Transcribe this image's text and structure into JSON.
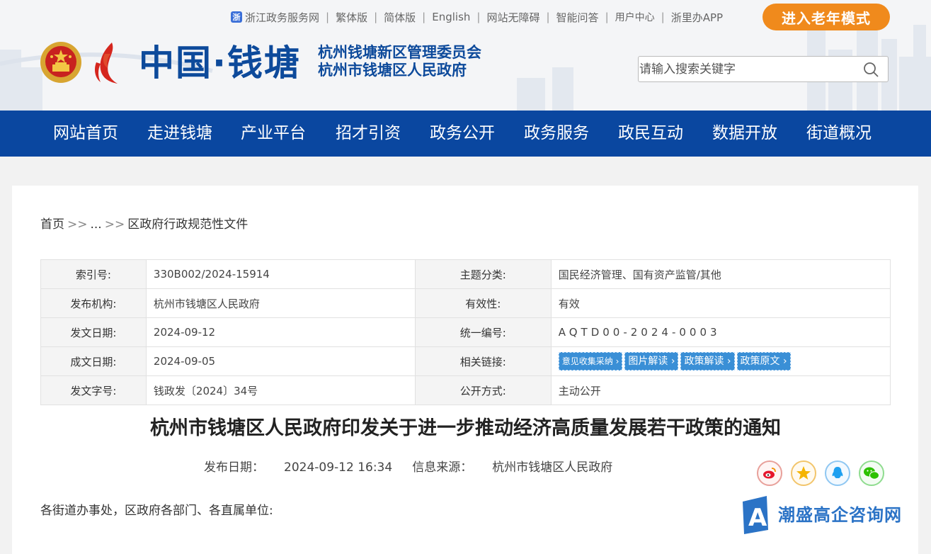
{
  "top_links": [
    "浙江政务服务网",
    "繁体版",
    "简体版",
    "English",
    "网站无障碍",
    "智能问答",
    "用户中心",
    "浙里办APP"
  ],
  "elder_mode_label": "进入老年模式",
  "brand": {
    "name": "中国·钱塘",
    "sub_line1": "杭州钱塘新区管理委员会",
    "sub_line2": "杭州市钱塘区人民政府"
  },
  "search": {
    "placeholder": "请输入搜索关键字"
  },
  "nav": [
    "网站首页",
    "走进钱塘",
    "产业平台",
    "招才引资",
    "政务公开",
    "政务服务",
    "政民互动",
    "数据开放",
    "街道概况"
  ],
  "breadcrumb": {
    "home": "首页",
    "sep": ">>",
    "ellipsis": "...",
    "current": "区政府行政规范性文件"
  },
  "meta": {
    "index_no_label": "索引号:",
    "index_no": "330B002/2024-15914",
    "topic_label": "主题分类:",
    "topic": "国民经济管理、国有资产监管/其他",
    "publisher_label": "发布机构:",
    "publisher": "杭州市钱塘区人民政府",
    "validity_label": "有效性:",
    "validity": "有效",
    "issue_date_label": "发文日期:",
    "issue_date": "2024-09-12",
    "unified_no_label": "统一编号:",
    "unified_no": "AQTD00-2024-0003",
    "written_date_label": "成文日期:",
    "written_date": "2024-09-05",
    "links_label": "相关链接:",
    "links": [
      "意见收集采纳",
      "图片解读",
      "政策解读",
      "政策原文"
    ],
    "doc_no_label": "发文字号:",
    "doc_no": "钱政发〔2024〕34号",
    "open_mode_label": "公开方式:",
    "open_mode": "主动公开"
  },
  "document": {
    "title": "杭州市钱塘区人民政府印发关于进一步推动经济高质量发展若干政策的通知",
    "pub_date_label": "发布日期：",
    "pub_date": "2024-09-12 16:34",
    "source_label": "信息来源：",
    "source": "杭州市钱塘区人民政府",
    "greeting": "各街道办事处，区政府各部门、各直属单位:"
  },
  "share_icons": [
    "weibo-icon",
    "qzone-icon",
    "qq-icon",
    "wechat-icon"
  ],
  "watermark": {
    "letter": "A",
    "text": "潮盛高企咨询网"
  },
  "colors": {
    "nav_blue": "#0a47a0",
    "brand_blue": "#0d4a9b",
    "elder_orange": "#f08a1c",
    "tag_blue": "#3a8fd6"
  }
}
